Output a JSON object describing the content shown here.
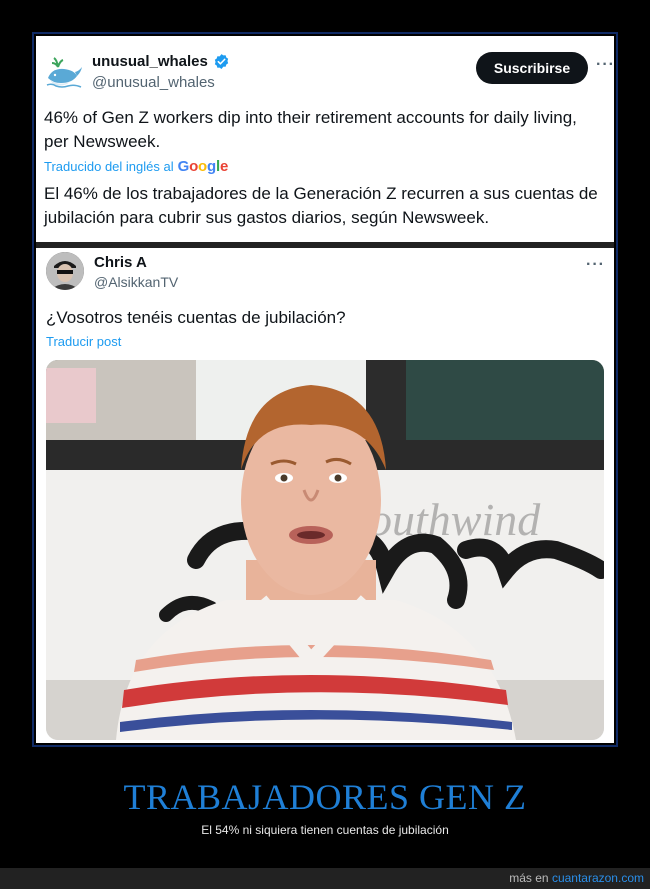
{
  "tweet": {
    "author_name": "unusual_whales",
    "author_handle": "@unusual_whales",
    "subscribe_label": "Suscribirse",
    "more_label": "···",
    "text_en": "46% of Gen Z workers dip into their retirement accounts for daily living, per Newsweek.",
    "translated_prefix": "Traducido del inglés al",
    "translator": {
      "G": "G",
      "o1": "o",
      "o2": "o",
      "g": "g",
      "l": "l",
      "e": "e"
    },
    "text_es": "El 46% de los trabajadores de la Generación Z recurren a sus cuentas de jubilación para cubrir sus gastos diarios, según Newsweek."
  },
  "reply": {
    "author_name": "Chris A",
    "author_handle": "@AlsikkanTV",
    "more_label": "···",
    "text": "¿Vosotros tenéis cuentas de jubilación?",
    "translate_label": "Traducir post",
    "media_sign_text": "Southwind"
  },
  "caption": {
    "title": "TRABAJADORES GEN Z",
    "subtitle": "El 54% ni siquiera tienen cuentas de jubilación"
  },
  "footer": {
    "prefix": "más en",
    "site": "cuantarazon.com"
  },
  "colors": {
    "accent": "#1d9bf0",
    "caption_title": "#1f7fd6",
    "button_bg": "#0f1419"
  }
}
